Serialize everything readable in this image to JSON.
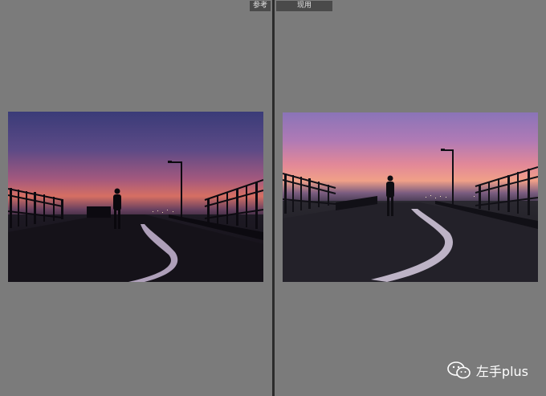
{
  "panes": {
    "left": {
      "tab_label": "参考"
    },
    "right": {
      "tab_label": "现用"
    }
  },
  "watermark": {
    "icon": "wechat-icon",
    "text": "左手plus"
  },
  "colors": {
    "background": "#7b7b7b",
    "divider": "#2b2b2b",
    "tab": "#4a4a4a"
  }
}
